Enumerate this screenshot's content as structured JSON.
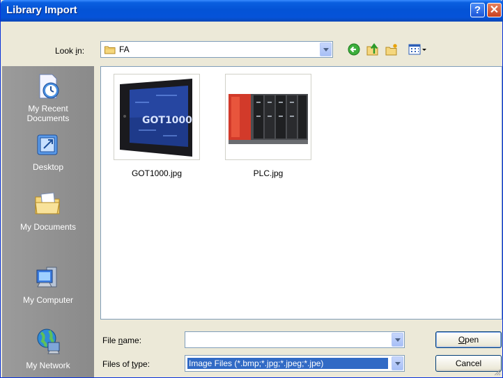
{
  "window": {
    "title": "Library Import"
  },
  "titlebar_buttons": {
    "help": "?",
    "close": "✕"
  },
  "lookin": {
    "label_pre": "Look ",
    "label_accel": "i",
    "label_post": "n:",
    "value": "FA"
  },
  "toolbar": {
    "icons": [
      "back-icon",
      "up-folder-icon",
      "new-folder-icon",
      "views-menu-icon"
    ]
  },
  "places": [
    {
      "line1": "My Recent",
      "line2": "Documents",
      "icon": "recent-documents-icon"
    },
    {
      "line1": "Desktop",
      "line2": "",
      "icon": "desktop-icon"
    },
    {
      "line1": "My Documents",
      "line2": "",
      "icon": "my-documents-icon"
    },
    {
      "line1": "My Computer",
      "line2": "",
      "icon": "my-computer-icon"
    },
    {
      "line1": "My Network",
      "line2": "",
      "icon": "my-network-icon"
    }
  ],
  "files": [
    {
      "name": "GOT1000.jpg",
      "thumb_text": "GOT1000"
    },
    {
      "name": "PLC.jpg",
      "thumb_text": ""
    }
  ],
  "file_name": {
    "label_pre": "File ",
    "label_accel": "n",
    "label_post": "ame:",
    "value": ""
  },
  "file_type": {
    "label_pre": "Files of ",
    "label_accel": "t",
    "label_post": "ype:",
    "value": "Image Files (*.bmp;*.jpg;*.jpeg;*.jpe)"
  },
  "buttons": {
    "open_accel": "O",
    "open_rest": "pen",
    "cancel": "Cancel"
  },
  "colors": {
    "title_bar": "#0453d6",
    "places_bg": "#8b8b8b",
    "selection": "#316ac5"
  }
}
